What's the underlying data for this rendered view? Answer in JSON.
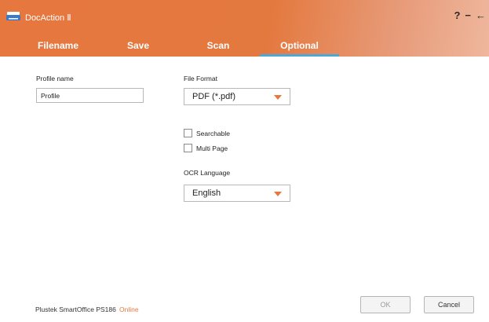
{
  "window": {
    "title": "DocAction Ⅱ",
    "help_label": "?",
    "minimize_label": "−",
    "back_label": "←"
  },
  "tabs": [
    {
      "label": "Filename",
      "active": false
    },
    {
      "label": "Save",
      "active": false
    },
    {
      "label": "Scan",
      "active": false
    },
    {
      "label": "Optional",
      "active": true
    }
  ],
  "profile": {
    "label": "Profile name",
    "value": "Profile"
  },
  "file_format": {
    "label": "File Format",
    "selected": "PDF (*.pdf)"
  },
  "options": {
    "searchable": {
      "label": "Searchable",
      "checked": false
    },
    "multi_page": {
      "label": "Multi Page",
      "checked": false
    }
  },
  "ocr": {
    "label": "OCR Language",
    "selected": "English"
  },
  "status": {
    "device": "Plustek SmartOffice PS186",
    "state": "Online"
  },
  "buttons": {
    "ok": "OK",
    "cancel": "Cancel"
  },
  "colors": {
    "accent": "#e4793f",
    "tab_indicator": "#4aa9d8"
  },
  "icons": {
    "app": "scanner-icon",
    "dropdown": "triangle-down-icon"
  }
}
